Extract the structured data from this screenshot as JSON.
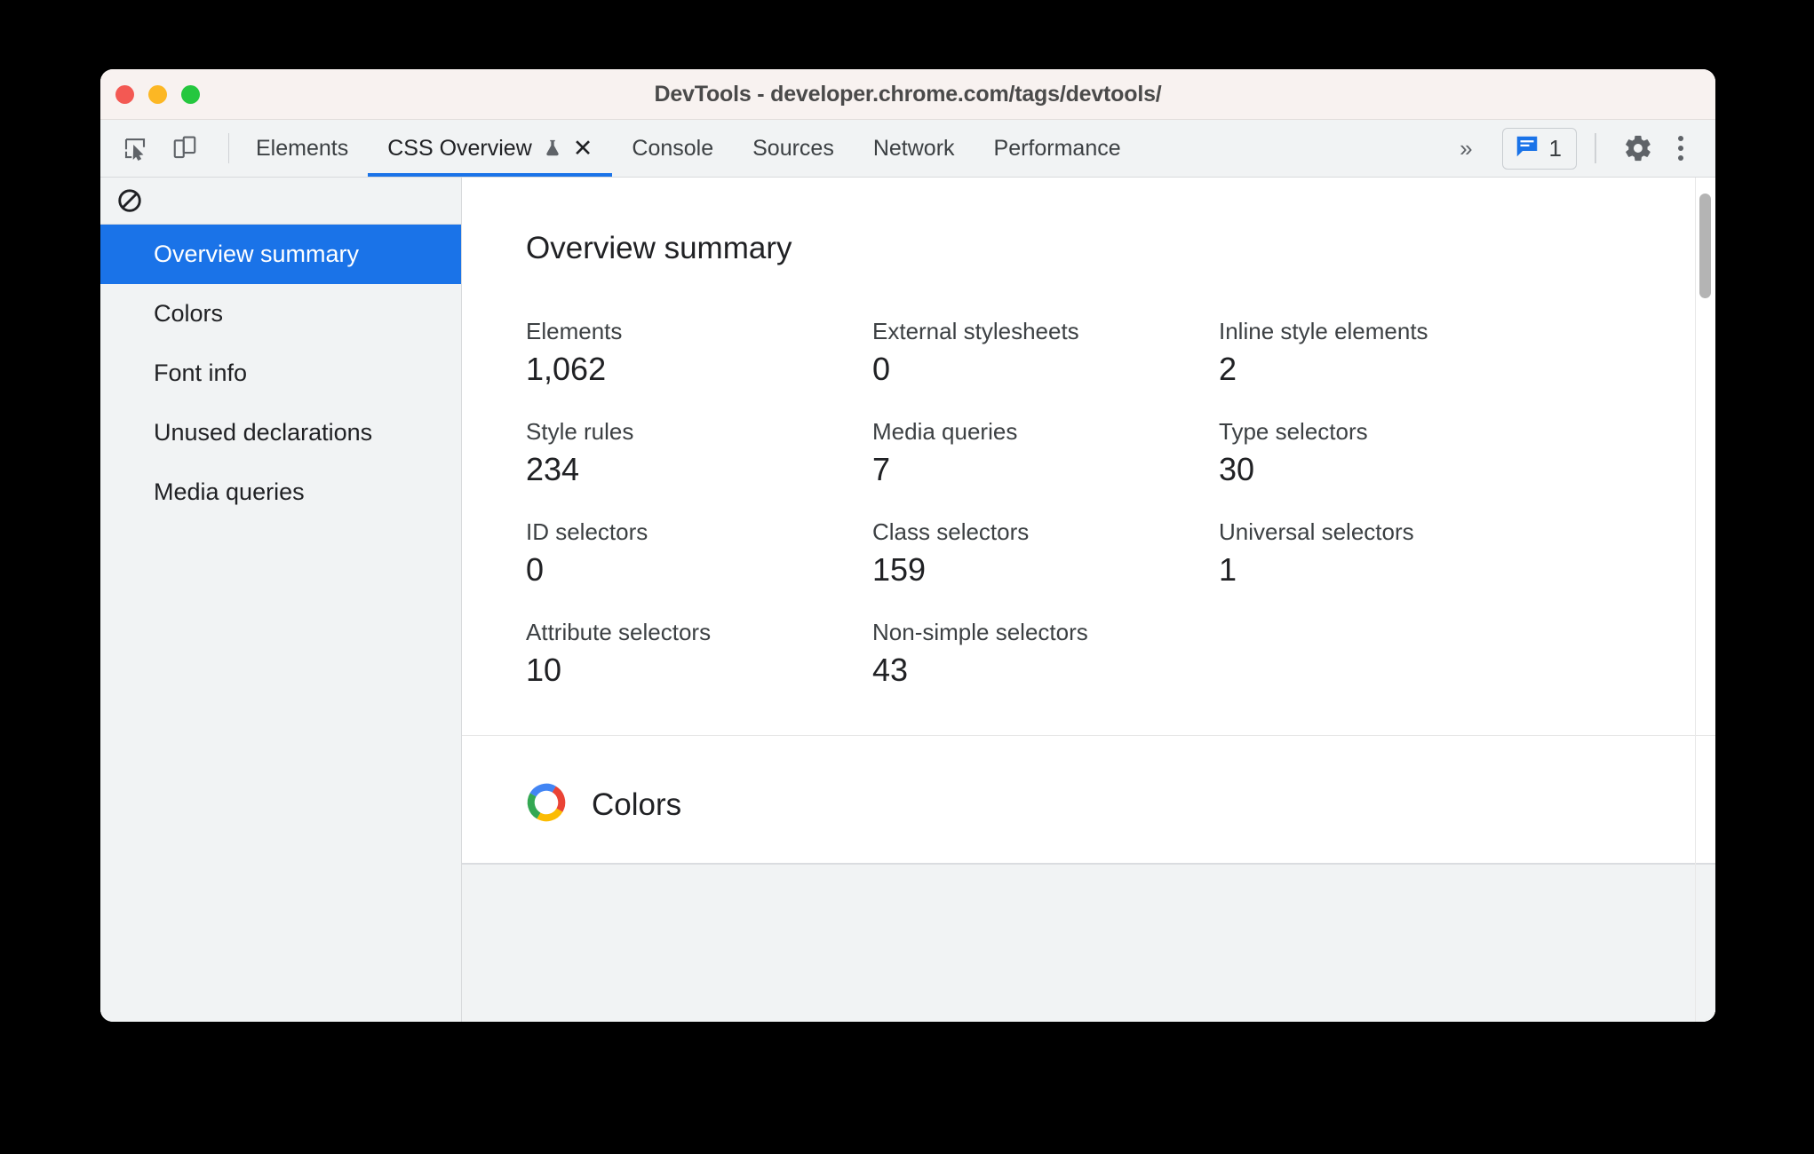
{
  "window": {
    "title": "DevTools - developer.chrome.com/tags/devtools/",
    "traffic_lights": [
      "close",
      "minimize",
      "zoom"
    ],
    "colors": {
      "accent": "#1a73e8",
      "titlebar_bg": "#f8f2f0",
      "toolbar_bg": "#f1f3f4",
      "red": "#f35953",
      "yellow": "#fcb724",
      "green": "#25c73f"
    }
  },
  "toolbar": {
    "inspect_icon": "inspect-element-icon",
    "device_icon": "device-toolbar-icon",
    "tabs": [
      {
        "label": "Elements",
        "active": false
      },
      {
        "label": "CSS Overview",
        "active": true,
        "experiment": true,
        "closable": true
      },
      {
        "label": "Console",
        "active": false
      },
      {
        "label": "Sources",
        "active": false
      },
      {
        "label": "Network",
        "active": false
      },
      {
        "label": "Performance",
        "active": false
      }
    ],
    "more_tabs_label": "»",
    "issues_count": "1",
    "issues_icon": "issues-message-icon",
    "settings_icon": "gear-icon",
    "more_options_icon": "kebab-menu-icon",
    "close_tab_glyph": "✕"
  },
  "sidebar": {
    "clear_icon": "block-clear-icon",
    "items": [
      {
        "label": "Overview summary",
        "selected": true
      },
      {
        "label": "Colors",
        "selected": false
      },
      {
        "label": "Font info",
        "selected": false
      },
      {
        "label": "Unused declarations",
        "selected": false
      },
      {
        "label": "Media queries",
        "selected": false
      }
    ]
  },
  "main": {
    "panel_title": "Overview summary",
    "metrics": [
      {
        "label": "Elements",
        "value": "1,062"
      },
      {
        "label": "External stylesheets",
        "value": "0"
      },
      {
        "label": "Inline style elements",
        "value": "2"
      },
      {
        "label": "Style rules",
        "value": "234"
      },
      {
        "label": "Media queries",
        "value": "7"
      },
      {
        "label": "Type selectors",
        "value": "30"
      },
      {
        "label": "ID selectors",
        "value": "0"
      },
      {
        "label": "Class selectors",
        "value": "159"
      },
      {
        "label": "Universal selectors",
        "value": "1"
      },
      {
        "label": "Attribute selectors",
        "value": "10"
      },
      {
        "label": "Non-simple selectors",
        "value": "43"
      },
      {
        "label": "",
        "value": ""
      }
    ],
    "colors_section": {
      "title": "Colors",
      "icon": "color-wheel-icon",
      "wheel_colors": [
        "#ea4335",
        "#fbbc04",
        "#34a853",
        "#4285f4"
      ]
    }
  }
}
